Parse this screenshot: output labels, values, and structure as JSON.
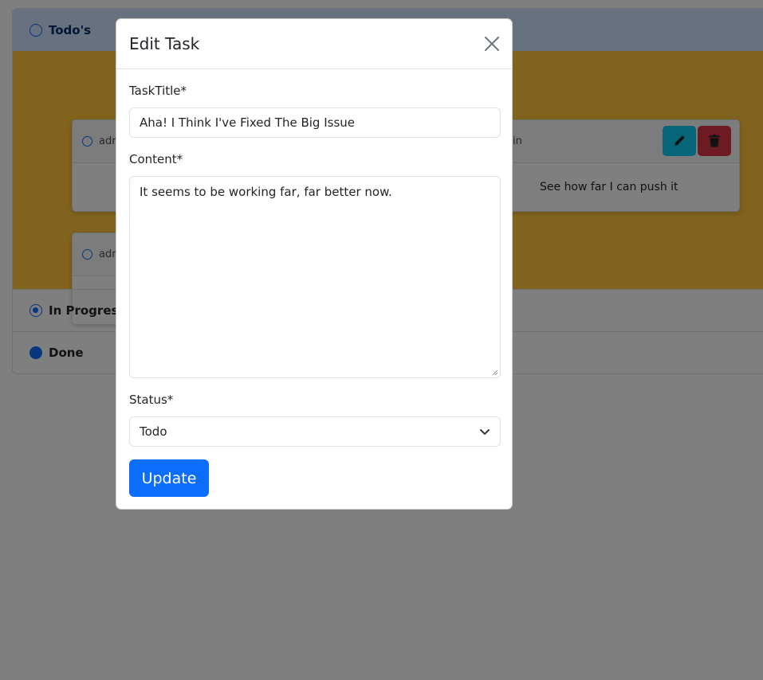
{
  "board": {
    "sections": {
      "todo": "Todo's",
      "in_progress": "In Progress",
      "done": "Done"
    },
    "cards": [
      {
        "owner": "adr",
        "owner_right": "in",
        "content": "See how far I can push it"
      },
      {
        "owner": "adr"
      }
    ]
  },
  "modal": {
    "title": "Edit Task",
    "fields": {
      "title_label": "TaskTitle*",
      "title_value": "Aha! I Think I've Fixed The Big Issue",
      "content_label": "Content*",
      "content_value": "It seems to be working far, far better now.",
      "status_label": "Status*",
      "status_value": "Todo"
    },
    "submit_label": "Update"
  },
  "colors": {
    "primary": "#0d6efd",
    "todo_body": "#ffc63c",
    "edit": "#0dcaf0",
    "delete": "#dc3545"
  },
  "icons": [
    "radio-icon",
    "pencil-icon",
    "trash-icon",
    "close-icon",
    "chevron-down-icon"
  ]
}
